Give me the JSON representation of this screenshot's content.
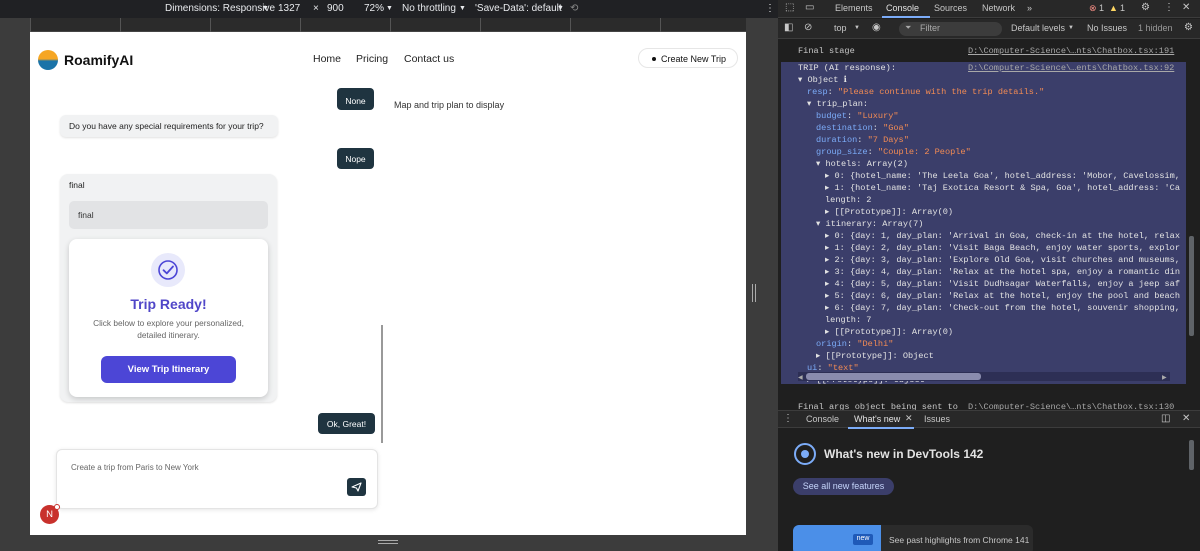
{
  "device_toolbar": {
    "dimensions_label": "Dimensions: Responsive",
    "width": "1327",
    "times": "×",
    "height": "900",
    "zoom": "72%",
    "throttling": "No throttling",
    "save_data": "'Save-Data': default"
  },
  "app": {
    "brand": "RoamifyAI",
    "nav": [
      "Home",
      "Pricing",
      "Contact us"
    ],
    "create_button": "Create New Trip",
    "map_placeholder": "Map and trip plan to display"
  },
  "chat": {
    "msg_none": "None",
    "msg_question": "Do you have any special requirements for your trip?",
    "msg_nope": "Nope",
    "msg_final": "final",
    "msg_final_inner": "final",
    "card": {
      "title": "Trip Ready!",
      "desc_line1": "Click below to explore your personalized,",
      "desc_line2": "detailed itinerary.",
      "button": "View Trip Itinerary"
    },
    "msg_ok": "Ok, Great!",
    "input_placeholder": "Create a trip from Paris to New York",
    "avatar_letter": "N"
  },
  "devtools": {
    "tabs": [
      "Elements",
      "Console",
      "Sources",
      "Network"
    ],
    "errors": "1",
    "warnings": "1",
    "context": "top",
    "filter_placeholder": "Filter",
    "levels": "Default levels",
    "issues": "No Issues",
    "hidden": "1 hidden",
    "log_final_stage": "Final stage",
    "log_final_stage_src": "D:\\Computer-Science\\…nts\\Chatbox.tsx:191",
    "log_trip": "TRIP (AI response):",
    "log_trip_src": "D:\\Computer-Science\\…ents\\Chatbox.tsx:92",
    "obj_lines": [
      {
        "indent": 0,
        "text": "▾ Object ℹ"
      },
      {
        "indent": 1,
        "key": "resp",
        "val": "\"Please continue with the trip details.\""
      },
      {
        "indent": 1,
        "text": "▾ trip_plan:"
      },
      {
        "indent": 2,
        "key": "budget",
        "val": "\"Luxury\""
      },
      {
        "indent": 2,
        "key": "destination",
        "val": "\"Goa\""
      },
      {
        "indent": 2,
        "key": "duration",
        "val": "\"7 Days\""
      },
      {
        "indent": 2,
        "key": "group_size",
        "val": "\"Couple: 2 People\""
      },
      {
        "indent": 2,
        "text": "▾ hotels: Array(2)"
      },
      {
        "indent": 3,
        "text": "▸ 0: {hotel_name: 'The Leela Goa', hotel_address: 'Mobor, Cavelossim,"
      },
      {
        "indent": 3,
        "text": "▸ 1: {hotel_name: 'Taj Exotica Resort & Spa, Goa', hotel_address: 'Ca"
      },
      {
        "indent": 3,
        "text": "length: 2"
      },
      {
        "indent": 3,
        "text": "▸ [[Prototype]]: Array(0)"
      },
      {
        "indent": 2,
        "text": "▾ itinerary: Array(7)"
      },
      {
        "indent": 3,
        "text": "▸ 0: {day: 1, day_plan: 'Arrival in Goa, check-in at the hotel, relax"
      },
      {
        "indent": 3,
        "text": "▸ 1: {day: 2, day_plan: 'Visit Baga Beach, enjoy water sports, explor"
      },
      {
        "indent": 3,
        "text": "▸ 2: {day: 3, day_plan: 'Explore Old Goa, visit churches and museums,"
      },
      {
        "indent": 3,
        "text": "▸ 3: {day: 4, day_plan: 'Relax at the hotel spa, enjoy a romantic din"
      },
      {
        "indent": 3,
        "text": "▸ 4: {day: 5, day_plan: 'Visit Dudhsagar Waterfalls, enjoy a jeep saf"
      },
      {
        "indent": 3,
        "text": "▸ 5: {day: 6, day_plan: 'Relax at the hotel, enjoy the pool and beach"
      },
      {
        "indent": 3,
        "text": "▸ 6: {day: 7, day_plan: 'Check-out from the hotel, souvenir shopping,"
      },
      {
        "indent": 3,
        "text": "length: 7"
      },
      {
        "indent": 3,
        "text": "▸ [[Prototype]]: Array(0)"
      },
      {
        "indent": 2,
        "key": "origin",
        "val": "\"Delhi\""
      },
      {
        "indent": 2,
        "text": "▸ [[Prototype]]: Object"
      },
      {
        "indent": 1,
        "key": "ui",
        "val": "\"text\""
      },
      {
        "indent": 1,
        "text": "▸ [[Prototype]]: Object"
      }
    ],
    "log_final_args": "Final args object being sent to",
    "log_final_args_src": "D:\\Computer-Science\\…nts\\Chatbox.tsx:130",
    "drawer_tabs": [
      "Console",
      "What's new",
      "Issues"
    ],
    "whats_new_title": "What's new in DevTools 142",
    "see_all": "See all new features",
    "new_badge": "new",
    "past_highlights": "See past highlights from Chrome 141"
  }
}
